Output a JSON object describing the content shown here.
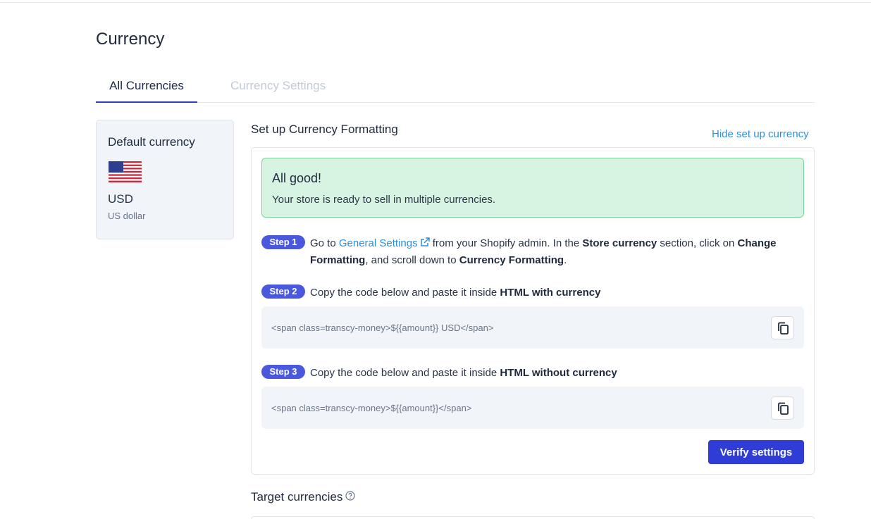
{
  "page": {
    "title": "Currency"
  },
  "tabs": [
    {
      "label": "All Currencies",
      "active": true
    },
    {
      "label": "Currency Settings",
      "active": false
    }
  ],
  "default_currency": {
    "label": "Default currency",
    "flag_icon": "us-flag-icon",
    "code": "USD",
    "name": "US dollar"
  },
  "setup": {
    "title": "Set up Currency Formatting",
    "hide_link": "Hide set up currency",
    "success": {
      "title": "All good!",
      "text": "Your store is ready to sell in multiple currencies."
    },
    "steps": [
      {
        "badge": "Step 1",
        "parts": {
          "go_to": "Go to ",
          "link": "General Settings",
          "mid1": " from your Shopify admin. In the ",
          "bold1": "Store currency",
          "mid2": " section, click on ",
          "bold2": "Change Formatting",
          "mid3": ", and scroll down to ",
          "bold3": "Currency Formatting",
          "end": "."
        }
      },
      {
        "badge": "Step 2",
        "text": "Copy the code below and paste it inside ",
        "bold": "HTML with currency",
        "code": "<span class=transcy-money>${{amount}} USD</span>"
      },
      {
        "badge": "Step 3",
        "text": "Copy the code below and paste it inside ",
        "bold": "HTML without currency",
        "code": "<span class=transcy-money>${{amount}}</span>"
      }
    ],
    "verify_button": "Verify settings"
  },
  "target": {
    "title": "Target currencies",
    "help_icon": "question-circle-icon"
  },
  "colors": {
    "accent": "#2f3cd6",
    "badge": "#4a58dd",
    "link": "#2d8fd8",
    "success_bg": "#d7f4e2",
    "success_border": "#7cd29a"
  }
}
